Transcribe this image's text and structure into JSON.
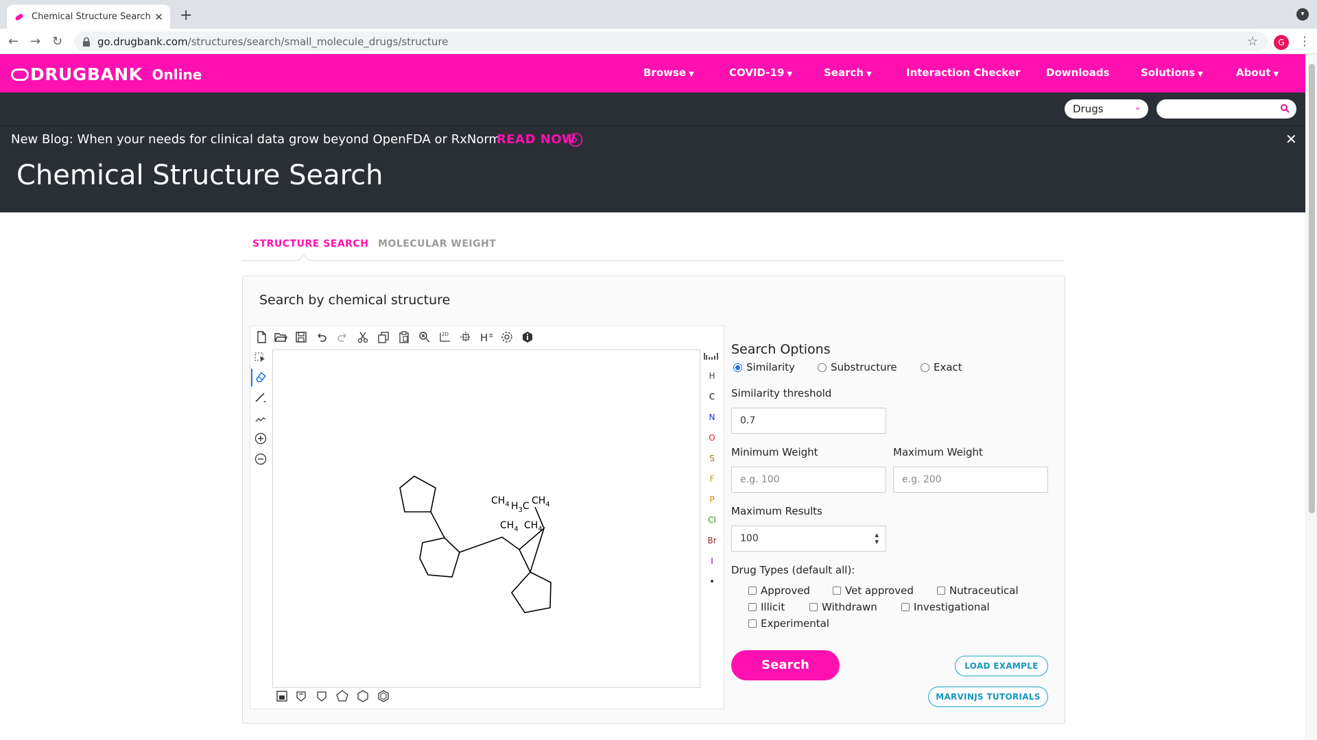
{
  "browser": {
    "tab_title": "Chemical Structure Search | Dr",
    "url_domain": "go.drugbank.com",
    "url_path": "/structures/search/small_molecule_drugs/structure",
    "profile_initial": "G"
  },
  "header": {
    "brand": "DRUGBANK",
    "brand_suffix": "Online",
    "nav": [
      {
        "label": "Browse"
      },
      {
        "label": "COVID-19"
      },
      {
        "label": "Search"
      },
      {
        "label": "Interaction Checker"
      },
      {
        "label": "Downloads"
      },
      {
        "label": "Solutions"
      },
      {
        "label": "About"
      }
    ]
  },
  "subheader": {
    "search_scope": "Drugs",
    "search_value": "",
    "blog_text": "New Blog: When your needs for clinical data grow beyond OpenFDA or RxNorm",
    "read_now": "READ NOW",
    "page_title": "Chemical Structure Search"
  },
  "tabs": [
    {
      "label": "STRUCTURE SEARCH",
      "active": true
    },
    {
      "label": "MOLECULAR WEIGHT",
      "active": false
    }
  ],
  "card": {
    "title": "Search by chemical structure"
  },
  "editor": {
    "elements": [
      {
        "symbol": "H",
        "color": "#444444"
      },
      {
        "symbol": "C",
        "color": "#000000"
      },
      {
        "symbol": "N",
        "color": "#2030d0"
      },
      {
        "symbol": "O",
        "color": "#e02020"
      },
      {
        "symbol": "S",
        "color": "#a08000"
      },
      {
        "symbol": "F",
        "color": "#b0a000"
      },
      {
        "symbol": "P",
        "color": "#e08000"
      },
      {
        "symbol": "Cl",
        "color": "#10a010"
      },
      {
        "symbol": "Br",
        "color": "#a02020"
      },
      {
        "symbol": "I",
        "color": "#8010a0"
      },
      {
        "symbol": "•",
        "color": "#000000"
      }
    ],
    "molecule_labels": {
      "a": "CH",
      "a_sub": "4",
      "b": "H",
      "b_sub": "3",
      "b_tail": "C",
      "c": "CH",
      "c_sub": "4",
      "d": "CH",
      "d_sub": "4",
      "e": "CH",
      "e_sub": "4"
    }
  },
  "options": {
    "title": "Search Options",
    "modes": [
      {
        "label": "Similarity",
        "selected": true
      },
      {
        "label": "Substructure",
        "selected": false
      },
      {
        "label": "Exact",
        "selected": false
      }
    ],
    "threshold_label": "Similarity threshold",
    "threshold_value": "0.7",
    "min_weight_label": "Minimum Weight",
    "min_weight_placeholder": "e.g. 100",
    "max_weight_label": "Maximum Weight",
    "max_weight_placeholder": "e.g. 200",
    "max_results_label": "Maximum Results",
    "max_results_value": "100",
    "drug_types_label": "Drug Types (default all):",
    "drug_types": [
      {
        "label": "Approved"
      },
      {
        "label": "Vet approved"
      },
      {
        "label": "Nutraceutical"
      },
      {
        "label": "Illicit"
      },
      {
        "label": "Withdrawn"
      },
      {
        "label": "Investigational"
      },
      {
        "label": "Experimental"
      }
    ],
    "search_button": "Search",
    "load_example": "LOAD EXAMPLE",
    "tutorials": "MARVINJS TUTORIALS"
  },
  "colors": {
    "brand_pink": "#ff10b0",
    "dark_band": "#2a2e35",
    "outline_blue": "#1fa3c9"
  }
}
